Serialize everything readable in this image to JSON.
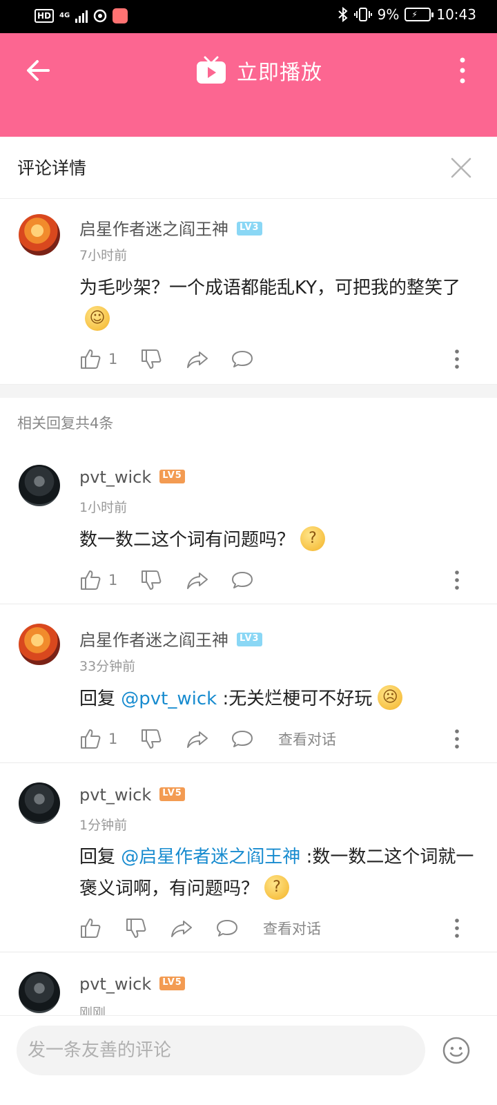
{
  "status_bar": {
    "hd": "HD",
    "network": "4G",
    "battery": "9%",
    "time": "10:43"
  },
  "appbar": {
    "title": "立即播放",
    "accent_color": "#fc6691"
  },
  "panel": {
    "title": "评论详情"
  },
  "main_comment": {
    "username": "启星作者迷之阎王神",
    "level": "LV3",
    "time": "7小时前",
    "text": "为毛吵架？一个成语都能乱KY，可把我的整笑了",
    "likes": "1"
  },
  "replies_label": "相关回复共4条",
  "replies": [
    {
      "username": "pvt_wick",
      "level": "LV5",
      "time": "1小时前",
      "text": "数一数二这个词有问题吗？",
      "likes": "1"
    },
    {
      "username": "启星作者迷之阎王神",
      "level": "LV3",
      "time": "33分钟前",
      "prefix": "回复",
      "mention": "@pvt_wick",
      "text": ":无关烂梗可不好玩",
      "likes": "1",
      "view_conversation": "查看对话"
    },
    {
      "username": "pvt_wick",
      "level": "LV5",
      "time": "1分钟前",
      "prefix": "回复",
      "mention": "@启星作者迷之阎王神",
      "text": ":数一数二这个词就一褒义词啊，有问题吗？",
      "view_conversation": "查看对话"
    },
    {
      "username": "pvt_wick",
      "level": "LV5",
      "time": "刚刚"
    }
  ],
  "input": {
    "placeholder": "发一条友善的评论"
  }
}
